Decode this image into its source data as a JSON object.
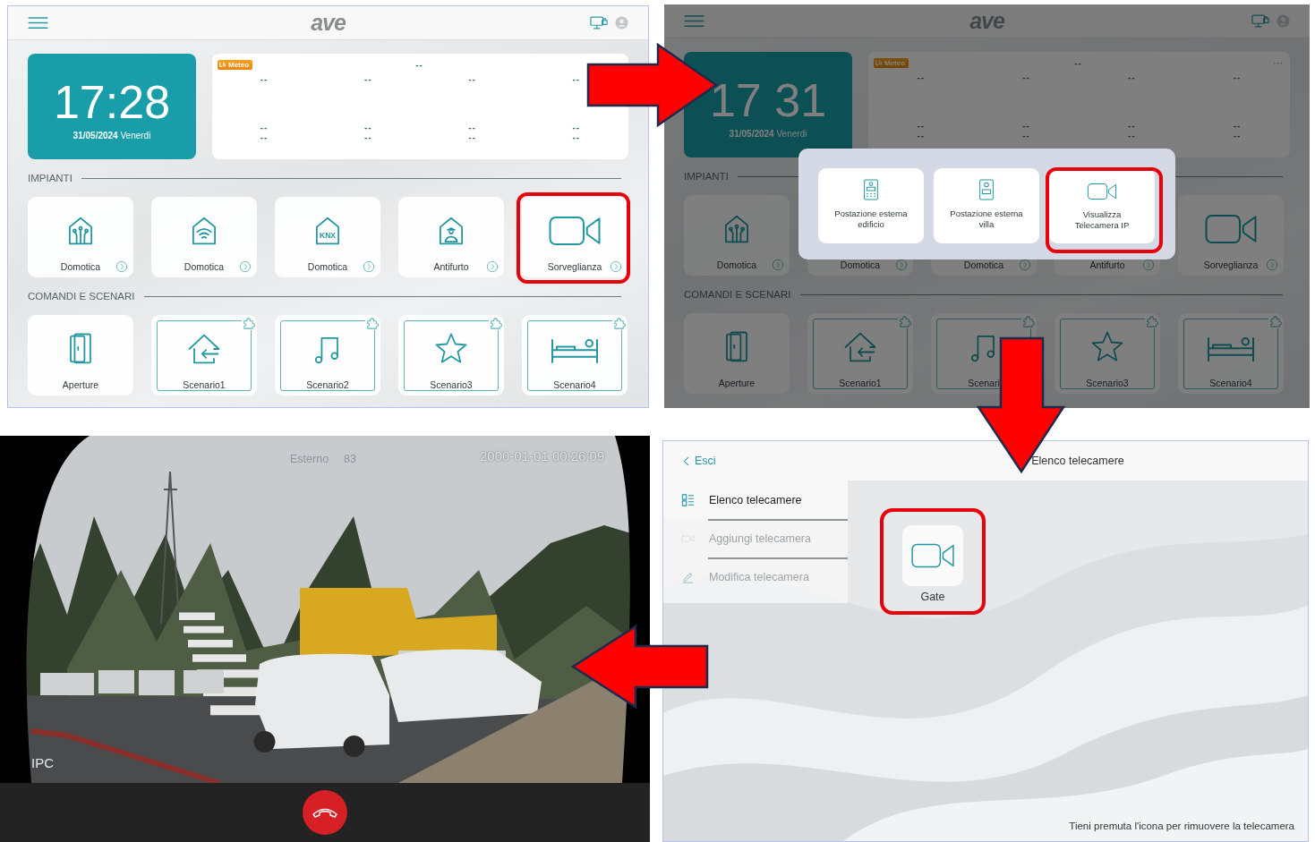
{
  "home_screen": {
    "dimmed": false,
    "logo": "ave",
    "clock": {
      "time": "17:28",
      "date": "**31/05/2024** Venerdi"
    },
    "weather": {
      "badge": "Meteo",
      "header": "--",
      "row1": [
        "--",
        "--",
        "--",
        "--"
      ],
      "row2": [
        [
          "--",
          "--"
        ],
        [
          "--",
          "--"
        ],
        [
          "--",
          "--"
        ],
        [
          "--",
          "--"
        ]
      ]
    },
    "sections": [
      {
        "title": "IMPIANTI",
        "tiles": [
          {
            "kind": "system",
            "label": "Domotica",
            "highlighted": false
          },
          {
            "kind": "system",
            "label": "Domotica",
            "highlighted": false
          },
          {
            "kind": "system",
            "icon_text": "KNX",
            "label": "Domotica",
            "highlighted": false
          },
          {
            "kind": "system",
            "label": "Antifurto",
            "highlighted": false
          },
          {
            "kind": "system",
            "label": "Sorveglianza",
            "highlighted": true
          }
        ]
      },
      {
        "title": "COMANDI E SCENARI",
        "tiles": [
          {
            "kind": "plain",
            "label": "Aperture",
            "highlighted": false
          },
          {
            "kind": "scenario",
            "label": "Scenario1",
            "highlighted": false
          },
          {
            "kind": "scenario",
            "label": "Scenario2",
            "highlighted": false
          },
          {
            "kind": "scenario",
            "label": "Scenario3",
            "highlighted": false
          },
          {
            "kind": "scenario",
            "label": "Scenario4",
            "highlighted": false
          }
        ]
      }
    ]
  },
  "menu_screen": {
    "dimmed": true,
    "logo": "ave",
    "clock": {
      "time": "17 31",
      "date": "**31/05/2024** Venerdi"
    },
    "weather": {
      "badge": "Meteo",
      "header": "--",
      "more": "···",
      "row1": [
        "--",
        "--",
        "--",
        "--"
      ],
      "row2": [
        [
          "--",
          "--"
        ],
        [
          "--",
          "--"
        ],
        [
          "--",
          "--"
        ],
        [
          "--",
          "--"
        ]
      ]
    },
    "sections": [
      {
        "title": "IMPIANTI",
        "tiles": [
          {
            "kind": "system",
            "label": "Domotica",
            "highlighted": false
          },
          {
            "kind": "system",
            "label": "Domotica",
            "highlighted": false
          },
          {
            "kind": "system",
            "label": "Domotica",
            "highlighted": false
          },
          {
            "kind": "system",
            "label": "Antifurto",
            "highlighted": false
          },
          {
            "kind": "system",
            "label": "Sorveglianza",
            "highlighted": false
          }
        ]
      },
      {
        "title": "COMANDI E SCENARI",
        "tiles": [
          {
            "kind": "plain",
            "label": "Aperture",
            "highlighted": false
          },
          {
            "kind": "scenario",
            "label": "Scenario1",
            "highlighted": false
          },
          {
            "kind": "scenario",
            "label": "Scenari",
            "highlighted": false
          },
          {
            "kind": "scenario",
            "label": "Scenario3",
            "highlighted": false
          },
          {
            "kind": "scenario",
            "label": "Scenario4",
            "highlighted": false
          }
        ]
      }
    ],
    "popup": {
      "options": [
        {
          "label": "Postazione esterna\nedificio",
          "highlighted": false
        },
        {
          "label": "Postazione esterna\nvilla",
          "highlighted": false
        },
        {
          "label": "Visualizza\nTelecamera IP",
          "highlighted": true
        }
      ]
    }
  },
  "camera_screen": {
    "location": "Esterno",
    "number": "83",
    "timestamp": "2000-01-01 00:26:09",
    "source": "IPC"
  },
  "camera_list_screen": {
    "back": "Esci",
    "title": "Elenco telecamere",
    "menu": [
      {
        "label": "Elenco telecamere",
        "selected": true
      },
      {
        "label": "Aggiungi telecamera",
        "selected": false
      },
      {
        "label": "Modifica telecamera",
        "selected": false
      }
    ],
    "cameras": [
      {
        "label": "Gate",
        "highlighted": true
      }
    ],
    "hint": "Tieni premuta l'icona per rimuovere la telecamera"
  }
}
